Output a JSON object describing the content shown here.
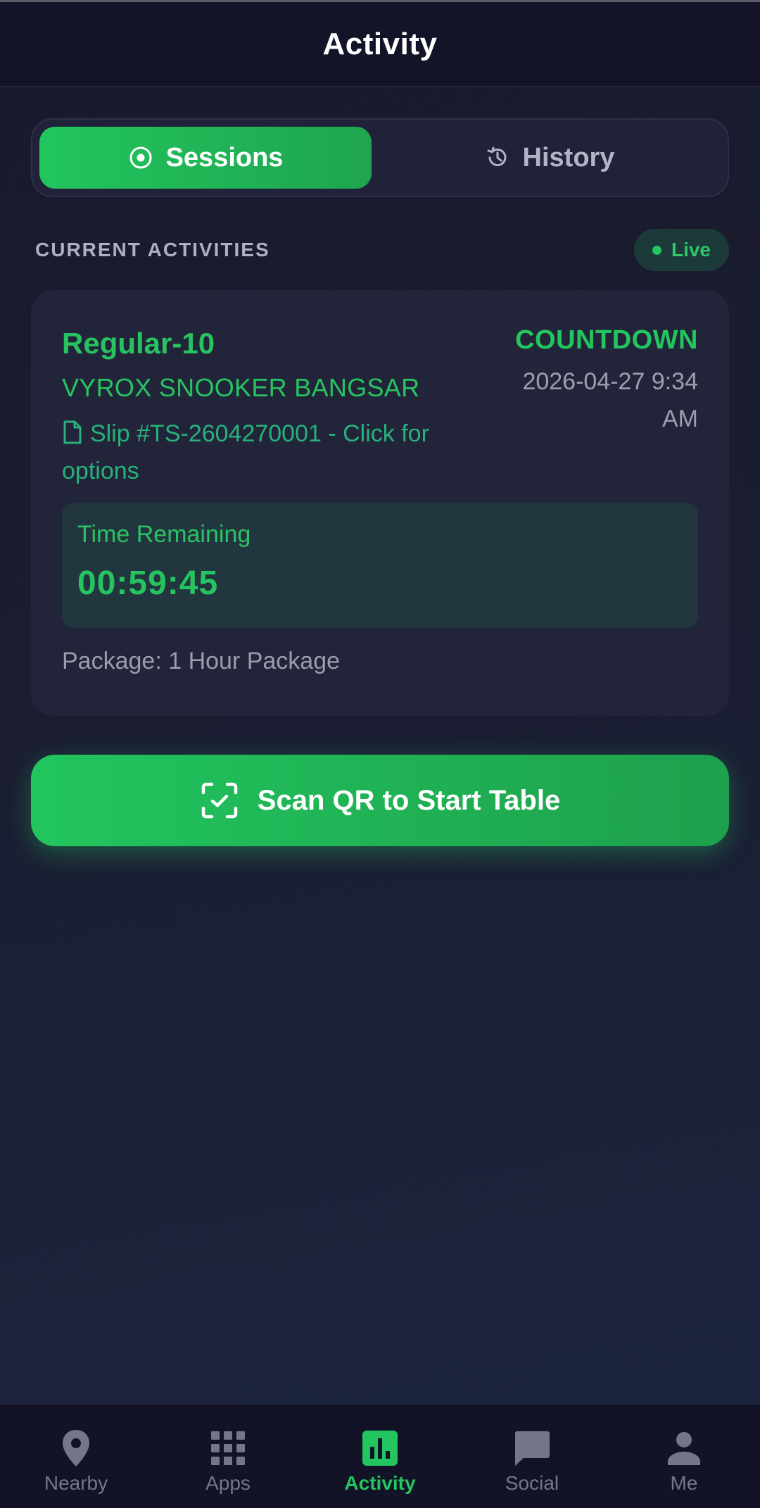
{
  "header": {
    "title": "Activity"
  },
  "tabs": [
    {
      "label": "Sessions",
      "icon": "radio-target-icon",
      "active": true
    },
    {
      "label": "History",
      "icon": "history-clock-icon",
      "active": false
    }
  ],
  "section": {
    "title": "CURRENT ACTIVITIES",
    "badge": "Live"
  },
  "activity": {
    "table_name": "Regular-10",
    "venue": "VYROX SNOOKER BANGSAR",
    "slip": "Slip #TS-2604270001 - Click for options",
    "mode": "COUNTDOWN",
    "datetime": "2026-04-27 9:34 AM",
    "timer_label": "Time Remaining",
    "timer_value": "00:59:45",
    "package": "Package: 1 Hour Package"
  },
  "scan_button": {
    "label": "Scan QR to Start Table"
  },
  "nav": [
    {
      "label": "Nearby",
      "icon": "location-pin-icon",
      "active": false
    },
    {
      "label": "Apps",
      "icon": "apps-grid-icon",
      "active": false
    },
    {
      "label": "Activity",
      "icon": "bar-chart-icon",
      "active": true
    },
    {
      "label": "Social",
      "icon": "chat-bubble-icon",
      "active": false
    },
    {
      "label": "Me",
      "icon": "person-icon",
      "active": false
    }
  ],
  "colors": {
    "accent": "#22c55e",
    "background": "#1b1e31",
    "card": "#22243a",
    "muted_text": "#9c9fb0"
  }
}
